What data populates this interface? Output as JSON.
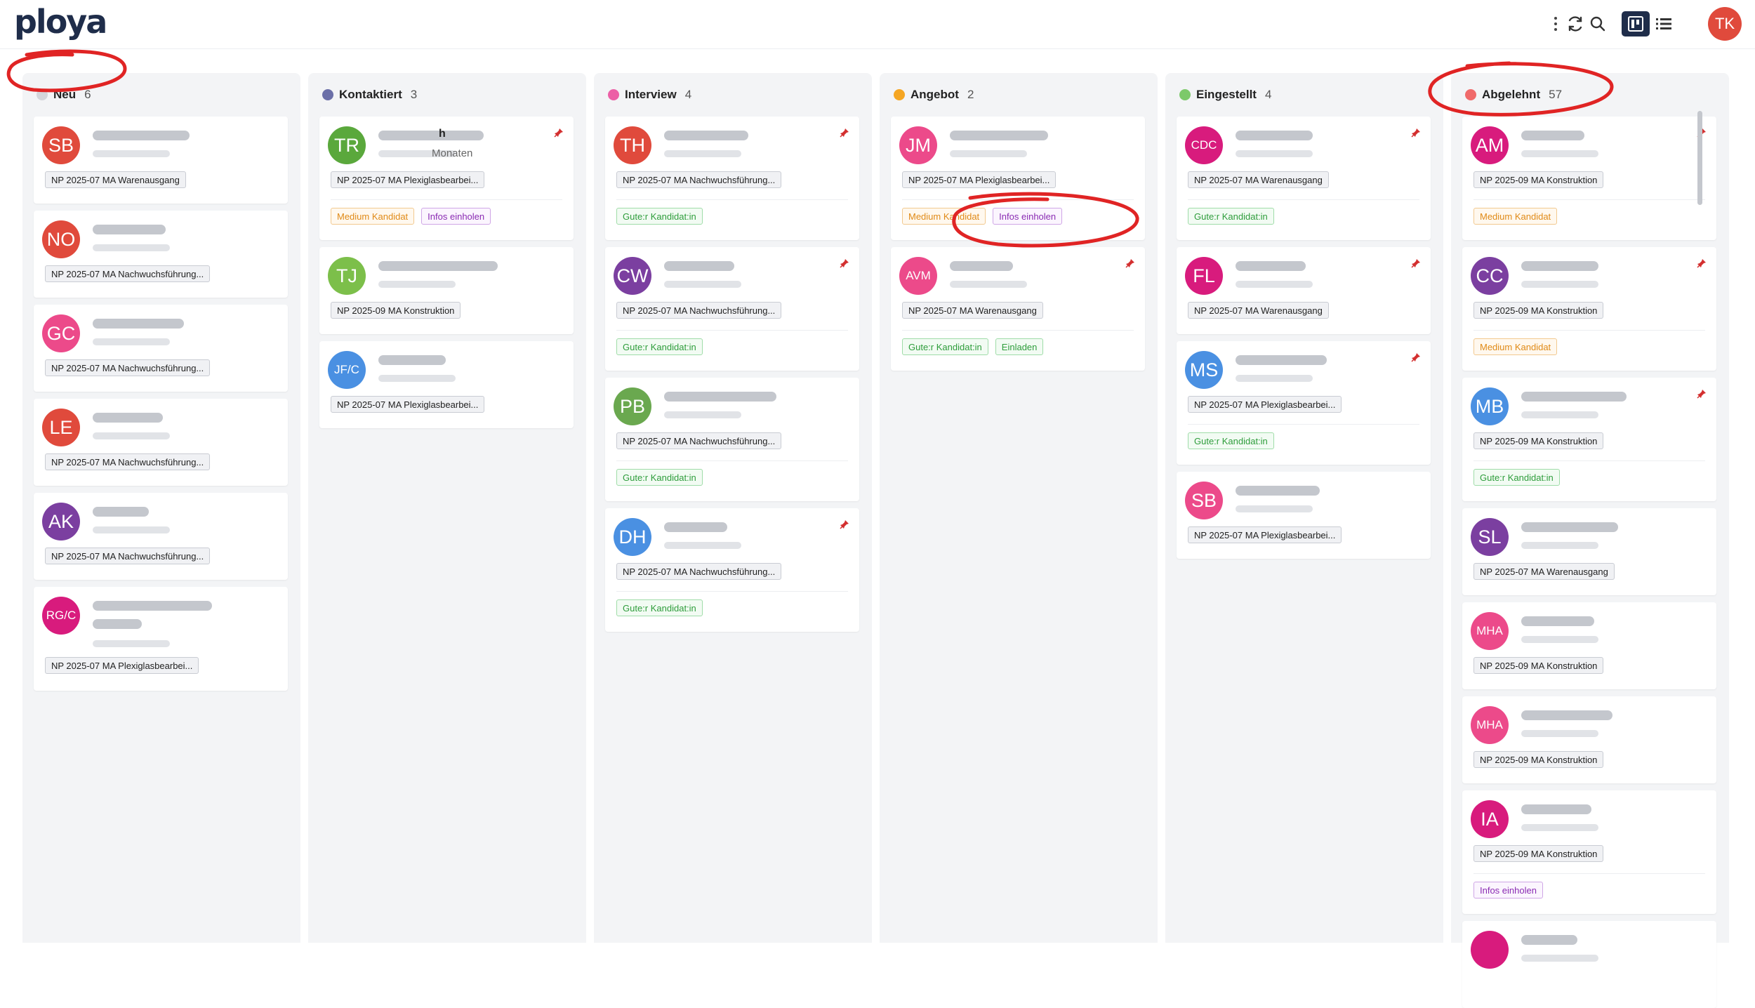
{
  "app": {
    "logo": "ploya",
    "user_initials": "TK"
  },
  "icons": {
    "more": "more-vertical-icon",
    "refresh": "refresh-icon",
    "search": "search-icon",
    "board_view": "kanban-icon",
    "list_view": "list-icon",
    "pin": "pin-icon"
  },
  "colors": {
    "accent": "#e04a3c",
    "brand": "#1f2d4a"
  },
  "columns": [
    {
      "title": "Neu",
      "count": "6",
      "dot": "#d4d5da",
      "cards": [
        {
          "initials": "SB",
          "color": "#e04a3c",
          "job": "NP 2025-07 MA Warenausgang",
          "tags": []
        },
        {
          "initials": "NO",
          "color": "#e04a3c",
          "job": "NP 2025-07 MA Nachwuchsführung...",
          "tags": []
        },
        {
          "initials": "GC",
          "color": "#ec4a8a",
          "job": "NP 2025-07 MA Nachwuchsführung...",
          "tags": []
        },
        {
          "initials": "LE",
          "color": "#e04a3c",
          "job": "NP 2025-07 MA Nachwuchsführung...",
          "tags": []
        },
        {
          "initials": "AK",
          "color": "#7b3fa0",
          "job": "NP 2025-07 MA Nachwuchsführung...",
          "tags": []
        },
        {
          "initials": "RG/C",
          "color": "#d81b7d",
          "job": "NP 2025-07 MA Plexiglasbearbei...",
          "tags": []
        }
      ]
    },
    {
      "title": "Kontaktiert",
      "count": "3",
      "dot": "#6b6fa8",
      "cards": [
        {
          "initials": "TR",
          "color": "#5aa83c",
          "name_partial": "h",
          "sub_partial": "Monaten",
          "job": "NP 2025-07 MA Plexiglasbearbei...",
          "tags": [
            {
              "label": "Medium Kandidat",
              "type": "orange"
            },
            {
              "label": "Infos einholen",
              "type": "purple"
            }
          ]
        },
        {
          "initials": "TJ",
          "color": "#7cbf4a",
          "job": "NP 2025-09 MA Konstruktion",
          "tags": []
        },
        {
          "initials": "JF/C",
          "color": "#4a90e2",
          "job": "NP 2025-07 MA Plexiglasbearbei...",
          "tags": []
        }
      ]
    },
    {
      "title": "Interview",
      "count": "4",
      "dot": "#ec5fa6",
      "cards": [
        {
          "initials": "TH",
          "color": "#e04a3c",
          "job": "NP 2025-07 MA Nachwuchsführung...",
          "tags": [
            {
              "label": "Gute:r Kandidat:in",
              "type": "green"
            }
          ]
        },
        {
          "initials": "CW",
          "color": "#7b3fa0",
          "job": "NP 2025-07 MA Nachwuchsführung...",
          "tags": [
            {
              "label": "Gute:r Kandidat:in",
              "type": "green"
            }
          ]
        },
        {
          "initials": "PB",
          "color": "#6aa84f",
          "job": "NP 2025-07 MA Nachwuchsführung...",
          "tags": [
            {
              "label": "Gute:r Kandidat:in",
              "type": "green"
            }
          ]
        },
        {
          "initials": "DH",
          "color": "#4a90e2",
          "job": "NP 2025-07 MA Nachwuchsführung...",
          "tags": [
            {
              "label": "Gute:r Kandidat:in",
              "type": "green"
            }
          ]
        }
      ]
    },
    {
      "title": "Angebot",
      "count": "2",
      "dot": "#f5a623",
      "cards": [
        {
          "initials": "JM",
          "color": "#ec4a8a",
          "job": "NP 2025-07 MA Plexiglasbearbei...",
          "tags": [
            {
              "label": "Medium Kandidat",
              "type": "orange"
            },
            {
              "label": "Infos einholen",
              "type": "purple"
            }
          ]
        },
        {
          "initials": "AVM",
          "color": "#ec4a8a",
          "job": "NP 2025-07 MA Warenausgang",
          "tags": [
            {
              "label": "Gute:r Kandidat:in",
              "type": "green"
            },
            {
              "label": "Einladen",
              "type": "green"
            }
          ]
        }
      ]
    },
    {
      "title": "Eingestellt",
      "count": "4",
      "dot": "#7cc96a",
      "cards": [
        {
          "initials": "CDC",
          "color": "#d81b7d",
          "job": "NP 2025-07 MA Warenausgang",
          "tags": [
            {
              "label": "Gute:r Kandidat:in",
              "type": "green"
            }
          ]
        },
        {
          "initials": "FL",
          "color": "#d81b7d",
          "job": "NP 2025-07 MA Warenausgang",
          "tags": []
        },
        {
          "initials": "MS",
          "color": "#4a90e2",
          "job": "NP 2025-07 MA Plexiglasbearbei...",
          "tags": [
            {
              "label": "Gute:r Kandidat:in",
              "type": "green"
            }
          ]
        },
        {
          "initials": "SB",
          "color": "#ec4a8a",
          "job": "NP 2025-07 MA Plexiglasbearbei...",
          "tags": []
        }
      ]
    },
    {
      "title": "Abgelehnt",
      "count": "57",
      "dot": "#f06a6a",
      "cards": [
        {
          "initials": "AM",
          "color": "#d81b7d",
          "job": "NP 2025-09 MA Konstruktion",
          "tags": [
            {
              "label": "Medium Kandidat",
              "type": "orange"
            }
          ]
        },
        {
          "initials": "CC",
          "color": "#7b3fa0",
          "job": "NP 2025-09 MA Konstruktion",
          "tags": [
            {
              "label": "Medium Kandidat",
              "type": "orange"
            }
          ]
        },
        {
          "initials": "MB",
          "color": "#4a90e2",
          "job": "NP 2025-09 MA Konstruktion",
          "tags": [
            {
              "label": "Gute:r Kandidat:in",
              "type": "green"
            }
          ]
        },
        {
          "initials": "SL",
          "color": "#7b3fa0",
          "job": "NP 2025-07 MA Warenausgang",
          "tags": []
        },
        {
          "initials": "MHA",
          "color": "#ec4a8a",
          "job": "NP 2025-09 MA Konstruktion",
          "tags": []
        },
        {
          "initials": "MHA",
          "color": "#ec4a8a",
          "job": "NP 2025-09 MA Konstruktion",
          "tags": []
        },
        {
          "initials": "IA",
          "color": "#d81b7d",
          "job": "NP 2025-09 MA Konstruktion",
          "tags": [
            {
              "label": "Infos einholen",
              "type": "purple"
            }
          ]
        },
        {
          "initials": "",
          "color": "#d81b7d",
          "job": "",
          "tags": []
        }
      ]
    }
  ]
}
